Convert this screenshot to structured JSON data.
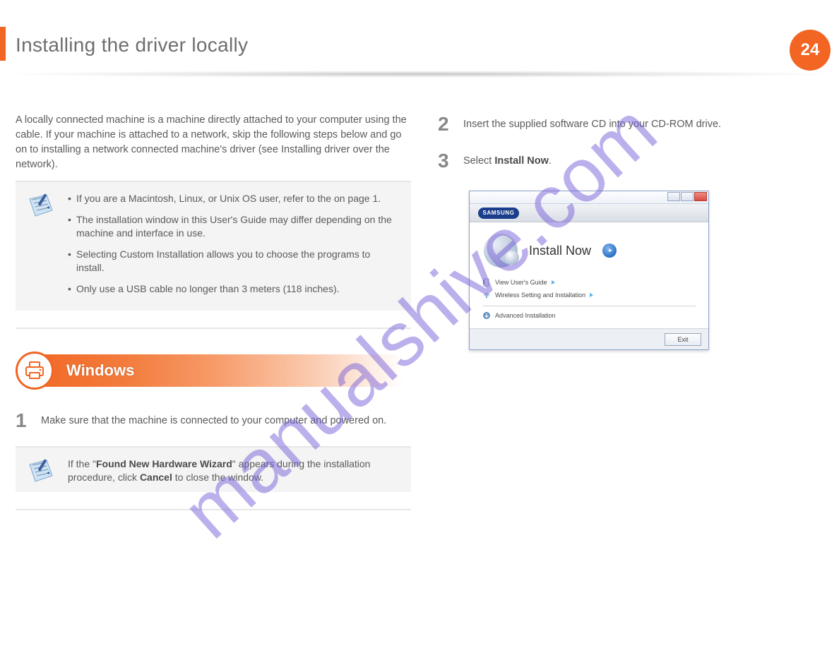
{
  "header": {
    "title": "Installing the driver locally",
    "page_number": "24"
  },
  "intro": "A locally connected machine is a machine directly attached to your computer using the cable. If your machine is attached to a network, skip the following steps below and go on to installing a network connected machine's driver (see Installing driver over the network).",
  "note1": {
    "items": [
      "If you are a Macintosh, Linux, or Unix OS user, refer to the on page 1.",
      "The installation window in this User's Guide may differ depending on the machine and interface in use.",
      "Selecting Custom Installation allows you to choose the programs to install.",
      "Only use a USB cable no longer than 3 meters (118 inches)."
    ]
  },
  "section_banner": "Windows",
  "left_step": {
    "num": "1",
    "text_pre": "Make sure that the machine is connected to your computer and powered on."
  },
  "note2": {
    "text_a": "If the \"",
    "text_bold": "Found New Hardware Wizard",
    "text_b": "\" appears during the installation procedure, click ",
    "text_bold2": "Cancel",
    "text_c": " to close the window."
  },
  "right_step2": {
    "num": "2",
    "text": "Insert the supplied software CD into your CD-ROM drive."
  },
  "right_step3": {
    "num": "3",
    "text_a": "Select ",
    "bold": "Install Now",
    "text_b": "."
  },
  "installer": {
    "brand": "SAMSUNG",
    "install_now": "Install Now",
    "view_guide": "View User's Guide",
    "wireless": "Wireless Setting and Installation",
    "advanced": "Advanced Installation",
    "exit": "Exit"
  },
  "watermark": "manualshive.com"
}
